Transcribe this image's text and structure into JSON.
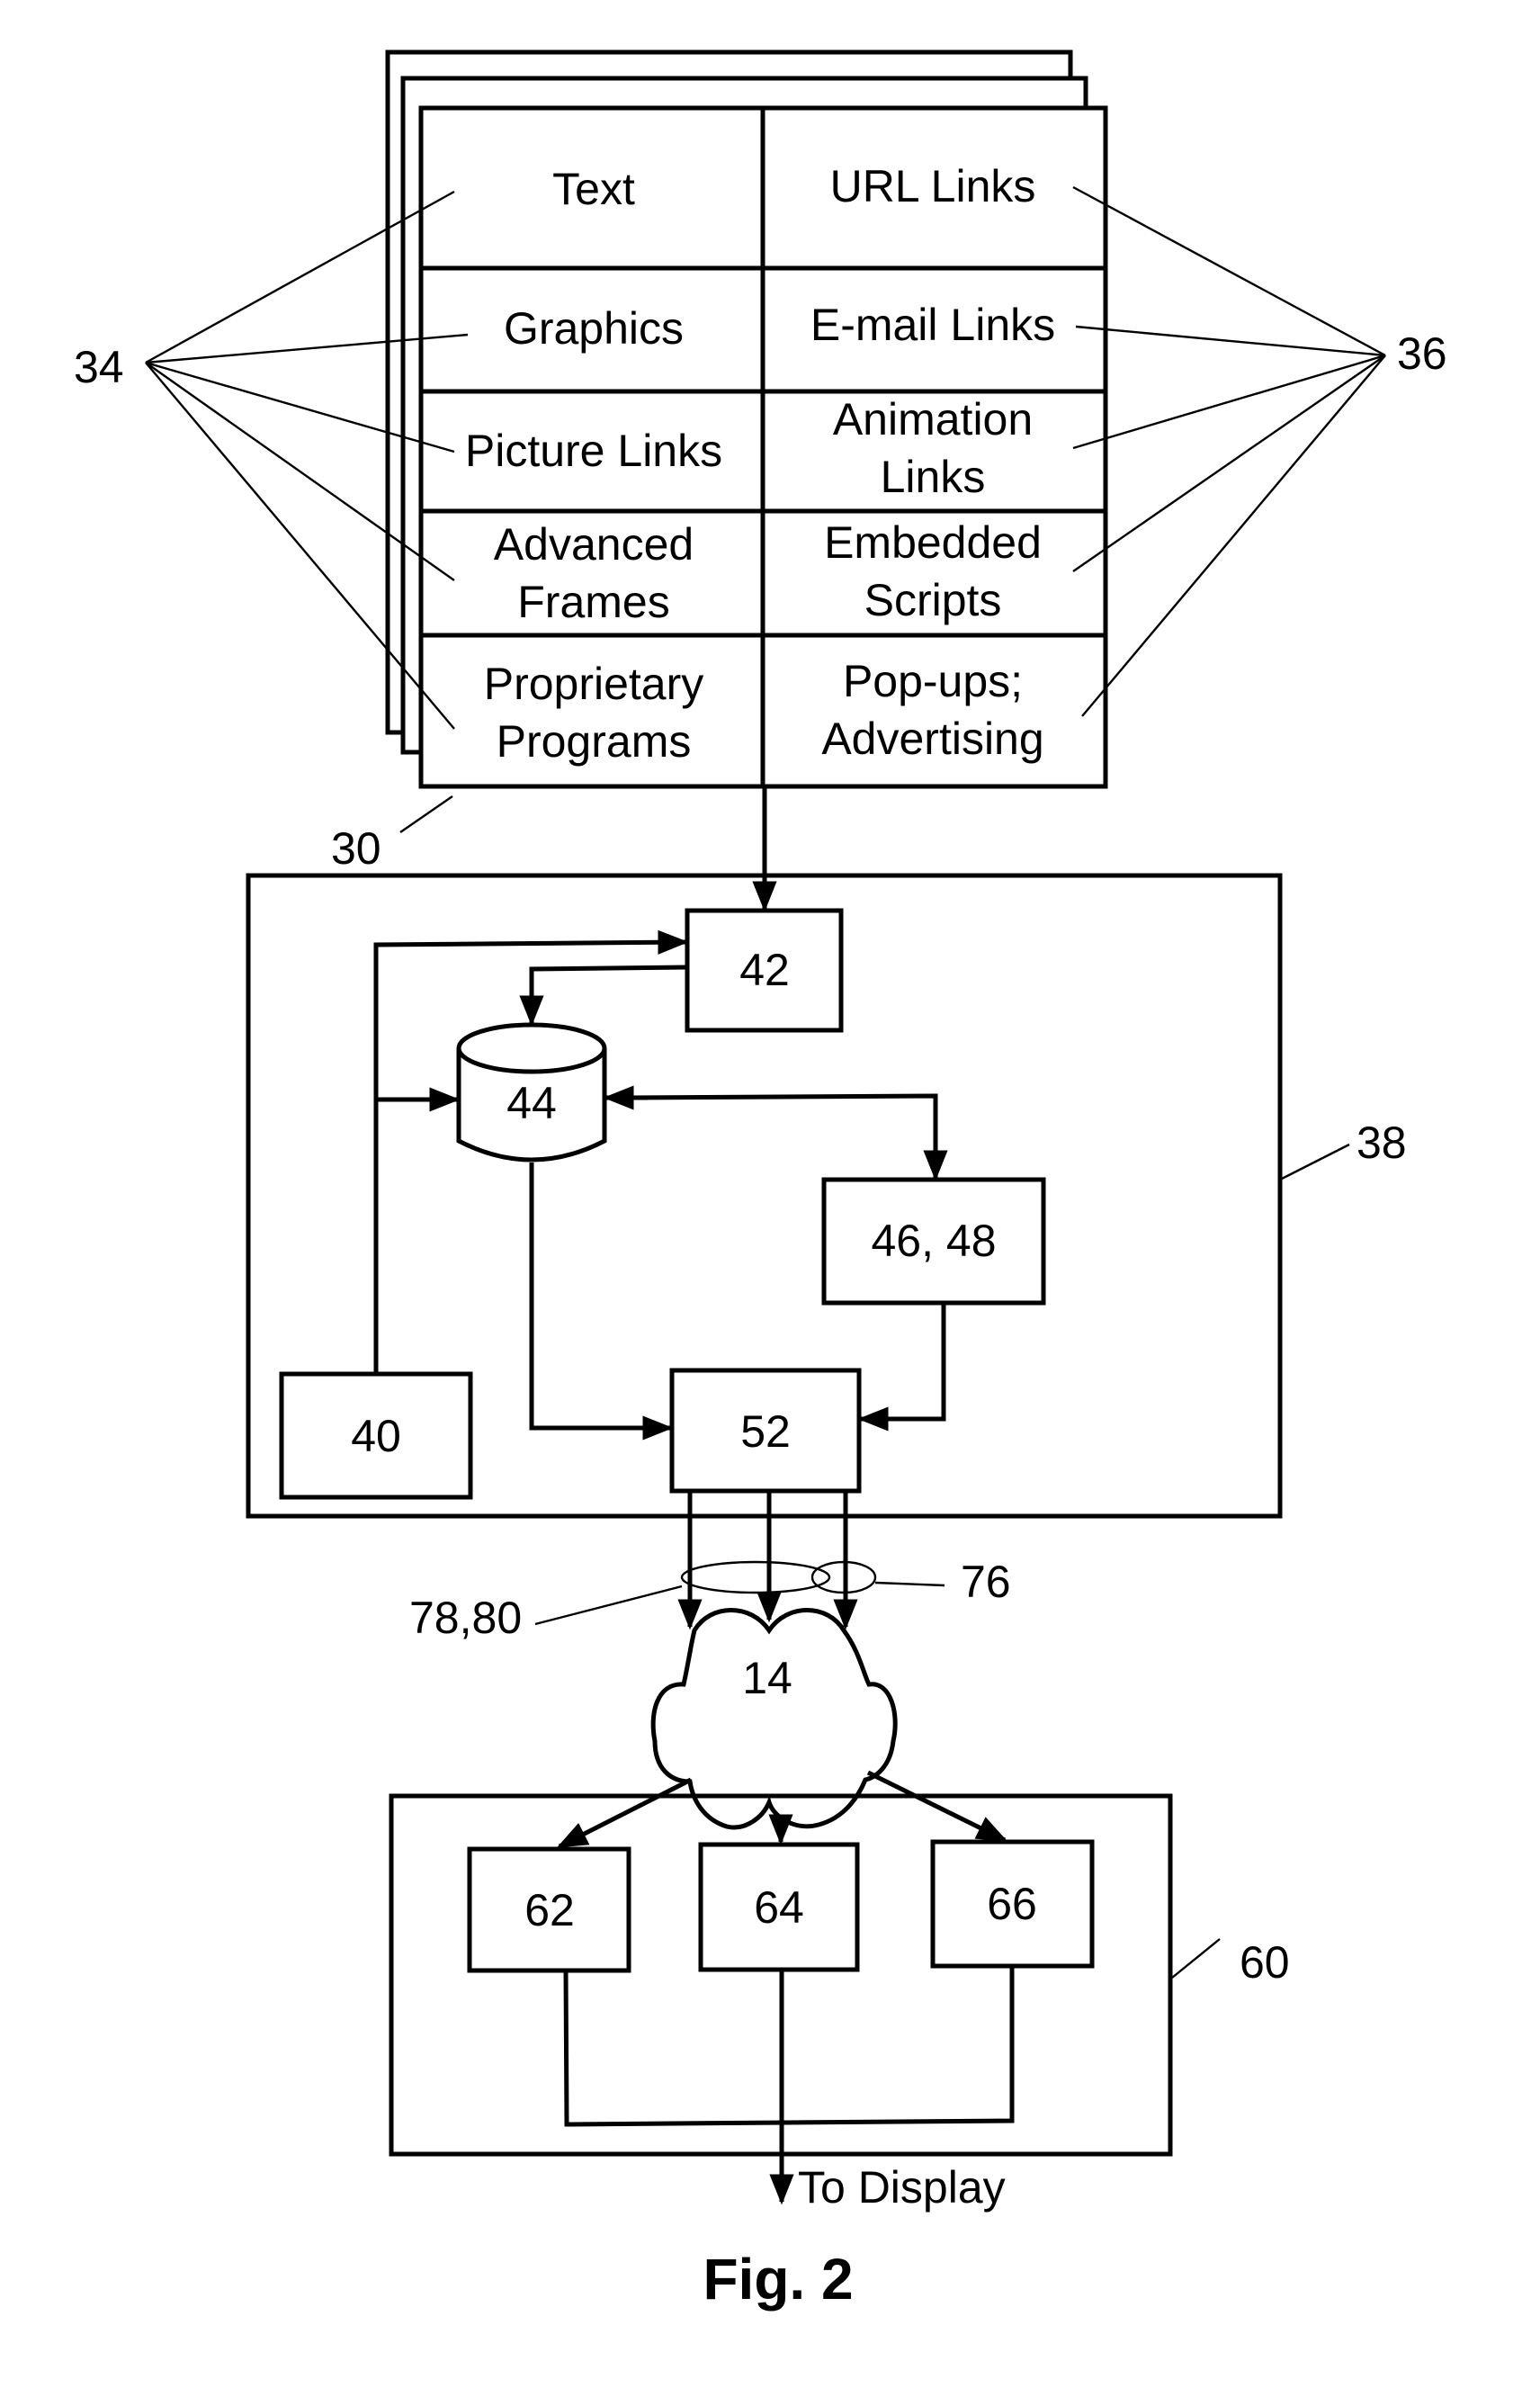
{
  "figure": {
    "caption": "Fig. 2"
  },
  "web_page_stack": {
    "ref": "30",
    "left_ref": "34",
    "right_ref": "36",
    "rows": [
      {
        "left": [
          "Text"
        ],
        "right": [
          "URL Links"
        ]
      },
      {
        "left": [
          "Graphics"
        ],
        "right": [
          "E-mail Links"
        ]
      },
      {
        "left": [
          "Picture Links"
        ],
        "right": [
          "Animation",
          "Links"
        ]
      },
      {
        "left": [
          "Advanced",
          "Frames"
        ],
        "right": [
          "Embedded",
          "Scripts"
        ]
      },
      {
        "left": [
          "Proprietary",
          "Programs"
        ],
        "right": [
          "Pop-ups;",
          "Advertising"
        ]
      }
    ]
  },
  "processing_block": {
    "ref": "38",
    "nodes": {
      "n42": "42",
      "n44": "44",
      "n46_48": "46, 48",
      "n40": "40",
      "n52": "52"
    }
  },
  "channel_refs": {
    "left": "78,80",
    "right": "76"
  },
  "network": {
    "label": "14"
  },
  "client_block": {
    "ref": "60",
    "nodes": {
      "n62": "62",
      "n64": "64",
      "n66": "66"
    },
    "output_label": "To Display"
  }
}
